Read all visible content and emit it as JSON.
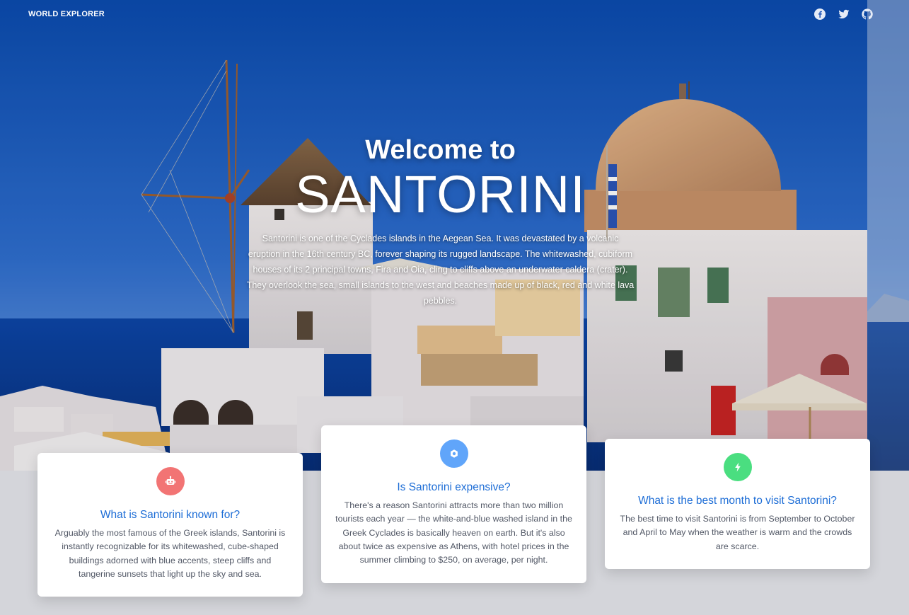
{
  "nav": {
    "brand": "WORLD EXPLORER",
    "social_icons": [
      "facebook-icon",
      "twitter-icon",
      "github-icon"
    ]
  },
  "hero": {
    "welcome": "Welcome to",
    "place": "SANTORINI",
    "description": "Santorini is one of the Cyclades islands in the Aegean Sea. It was devastated by a volcanic eruption in the 16th century BC, forever shaping its rugged landscape. The whitewashed, cubiform houses of its 2 principal towns, Fira and Oia, cling to cliffs above an underwater caldera (crater). They overlook the sea, small islands to the west and beaches made up of black, red and white lava pebbles."
  },
  "cards": [
    {
      "icon": "robot-icon",
      "icon_color": "#f27474",
      "title": "What is Santorini known for?",
      "text": "Arguably the most famous of the Greek islands, Santorini is instantly recognizable for its whitewashed, cube-shaped buildings adorned with blue accents, steep cliffs and tangerine sunsets that light up the sky and sea."
    },
    {
      "icon": "cog-icon",
      "icon_color": "#60a5fa",
      "title": "Is Santorini expensive?",
      "text": "There's a reason Santorini attracts more than two million tourists each year — the white-and-blue washed island in the Greek Cyclades is basically heaven on earth. But it's also about twice as expensive as Athens, with hotel prices in the summer climbing to $250, on average, per night."
    },
    {
      "icon": "lightning-icon",
      "icon_color": "#4ade80",
      "title": "What is the best month to visit Santorini?",
      "text": "The best time to visit Santorini is from September to October and April to May when the weather is warm and the crowds are scarce."
    }
  ],
  "colors": {
    "page_background": "#d4d5da",
    "card_title": "#1d6dd6",
    "card_text": "#525866",
    "sky_top": "#0b4fb3",
    "sea": "#0a3f9a"
  }
}
